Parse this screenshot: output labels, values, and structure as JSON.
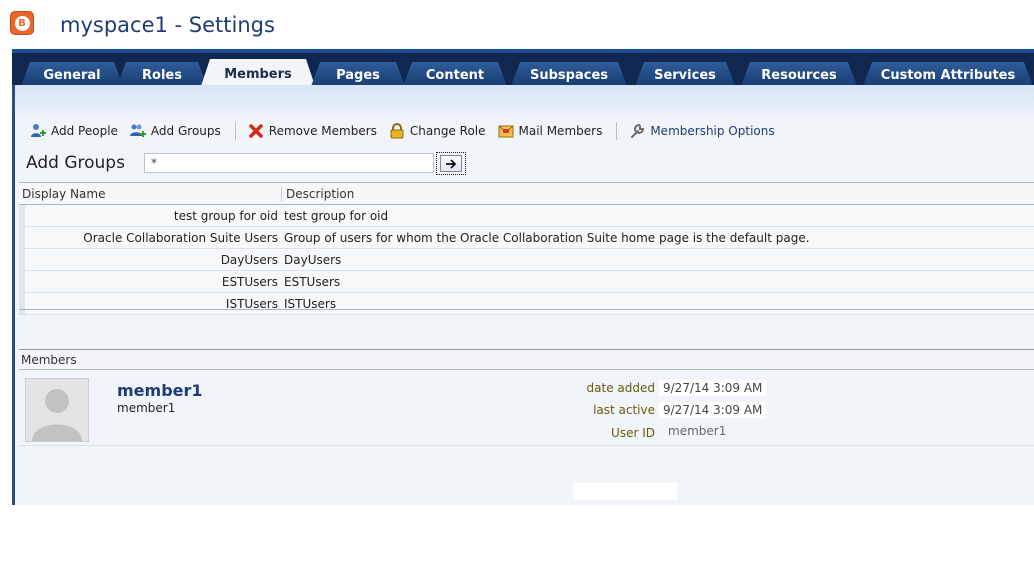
{
  "app": {
    "icon_letter": "B",
    "title": "myspace1 - Settings"
  },
  "tabs": [
    {
      "label": "General",
      "active": false
    },
    {
      "label": "Roles",
      "active": false
    },
    {
      "label": "Members",
      "active": true
    },
    {
      "label": "Pages",
      "active": false
    },
    {
      "label": "Content",
      "active": false
    },
    {
      "label": "Subspaces",
      "active": false
    },
    {
      "label": "Services",
      "active": false
    },
    {
      "label": "Resources",
      "active": false
    },
    {
      "label": "Custom Attributes",
      "active": false
    }
  ],
  "toolbar": {
    "add_people": "Add People",
    "add_groups": "Add Groups",
    "remove_members": "Remove Members",
    "change_role": "Change Role",
    "mail_members": "Mail Members",
    "membership_options": "Membership Options"
  },
  "search": {
    "label": "Add Groups",
    "value": "*"
  },
  "groups_table": {
    "columns": [
      "Display Name",
      "Description"
    ],
    "rows": [
      {
        "name": "test group for oid",
        "description": "test group for oid"
      },
      {
        "name": "Oracle Collaboration Suite Users",
        "description": "Group of users for whom the Oracle Collaboration Suite home page is the default page."
      },
      {
        "name": "DayUsers",
        "description": "DayUsers"
      },
      {
        "name": "ESTUsers",
        "description": "ESTUsers"
      },
      {
        "name": "ISTUsers",
        "description": "ISTUsers"
      }
    ]
  },
  "members": {
    "header": "Members",
    "list": [
      {
        "name": "member1",
        "username": "member1",
        "date_added_label": "date added",
        "date_added": "9/27/14 3:09 AM",
        "last_active_label": "last active",
        "last_active": "9/27/14 3:09 AM",
        "user_id_label": "User ID",
        "user_id": "member1"
      }
    ]
  },
  "colors": {
    "tabbar": "#10284f",
    "tab": "#2f5c9a",
    "title": "#1f3c78",
    "accent_orange": "#e8672a"
  }
}
